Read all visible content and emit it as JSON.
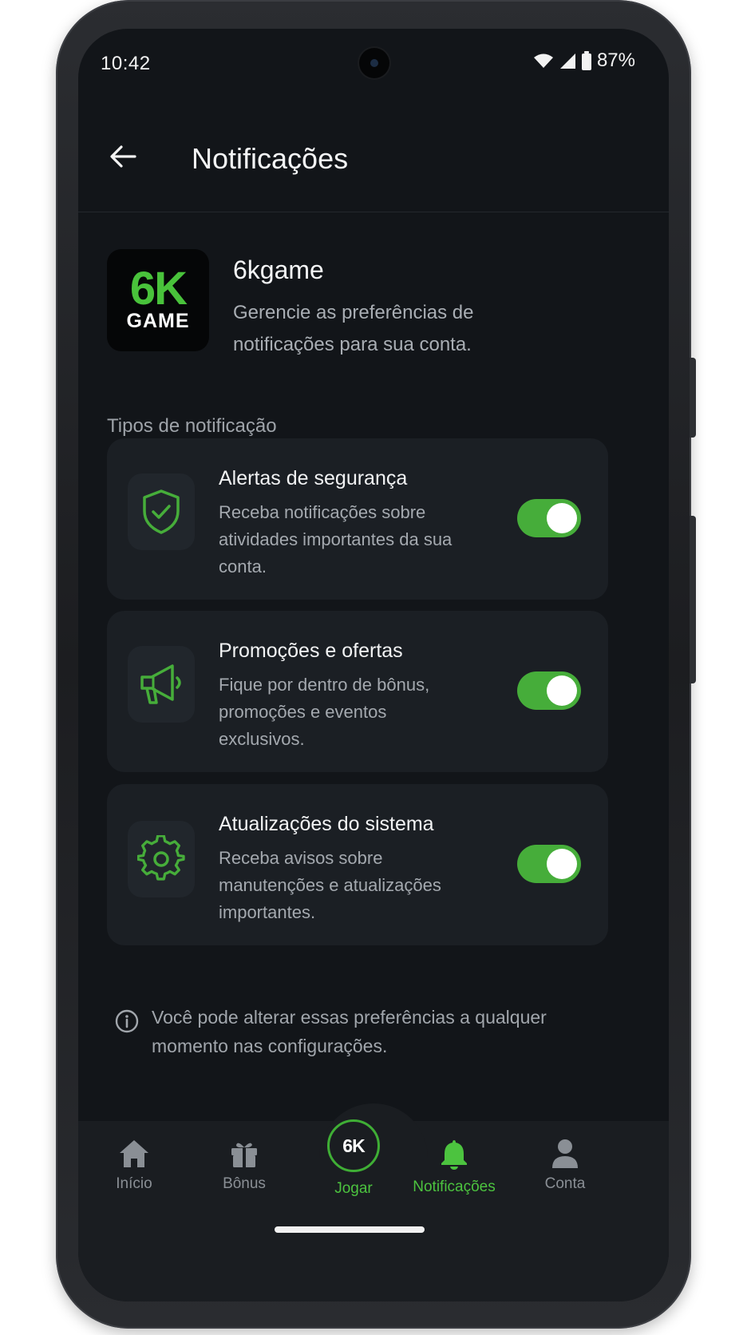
{
  "status_bar": {
    "time": "10:42",
    "battery": "87%",
    "icons": [
      "wifi-icon",
      "signal-icon",
      "battery-icon"
    ]
  },
  "appbar": {
    "title": "Notificações",
    "back_icon": "arrow-left-icon"
  },
  "brand": {
    "logo_top": "6K",
    "logo_bottom": "GAME",
    "name": "6kgame",
    "description": "Gerencie as preferências de notificações para sua conta."
  },
  "section_label": "Tipos de notificação",
  "settings": [
    {
      "icon": "shield-check-icon",
      "title": "Alertas de segurança",
      "description": "Receba notificações sobre atividades importantes da sua conta.",
      "enabled": true
    },
    {
      "icon": "megaphone-icon",
      "title": "Promoções e ofertas",
      "description": "Fique por dentro de bônus, promoções e eventos exclusivos.",
      "enabled": true
    },
    {
      "icon": "gear-icon",
      "title": "Atualizações do sistema",
      "description": "Receba avisos sobre manutenções e atualizações importantes.",
      "enabled": true
    }
  ],
  "info_note": "Você pode alterar essas preferências a qualquer momento nas configurações.",
  "nav": {
    "items": [
      {
        "label": "Início",
        "icon": "home-icon"
      },
      {
        "label": "Bônus",
        "icon": "gift-icon"
      },
      {
        "label": "Jogar",
        "icon": "6k-logo-icon"
      },
      {
        "label": "Notificações",
        "icon": "bell-icon"
      },
      {
        "label": "Conta",
        "icon": "user-icon"
      }
    ],
    "play_badge": "6K",
    "active": "Notificações"
  },
  "colors": {
    "accent": "#46ad3a",
    "background": "#121519",
    "card": "#1b1f24"
  }
}
